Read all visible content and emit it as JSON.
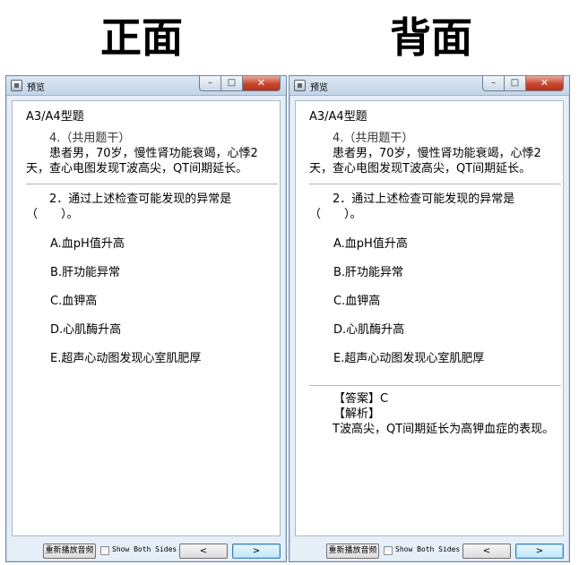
{
  "headings": {
    "front": "正面",
    "back": "背面"
  },
  "window": {
    "title": "预览",
    "controls": {
      "minimize": "–",
      "maximize": "□",
      "close": "✕"
    }
  },
  "question": {
    "type": "A3/A4型题",
    "number": "4.（共用题干）",
    "case": "患者男，70岁，慢性肾功能衰竭，心悸2天，查心电图发现T波高尖，QT间期延长。",
    "stem": "2．通过上述检查可能发现的异常是（　　）。",
    "options": [
      "A.血pH值升高",
      "B.肝功能异常",
      "C.血钾高",
      "D.心肌酶升高",
      "E.超声心动图发现心室肌肥厚"
    ]
  },
  "answer": {
    "answer_line": "【答案】C",
    "analysis_label": "【解析】",
    "analysis_text": "T波高尖，QT间期延长为高钾血症的表现。"
  },
  "footer": {
    "replay_label": "重新播放音频",
    "show_both_label": "Show Both Sides",
    "prev_label": "<",
    "next_label": ">"
  }
}
